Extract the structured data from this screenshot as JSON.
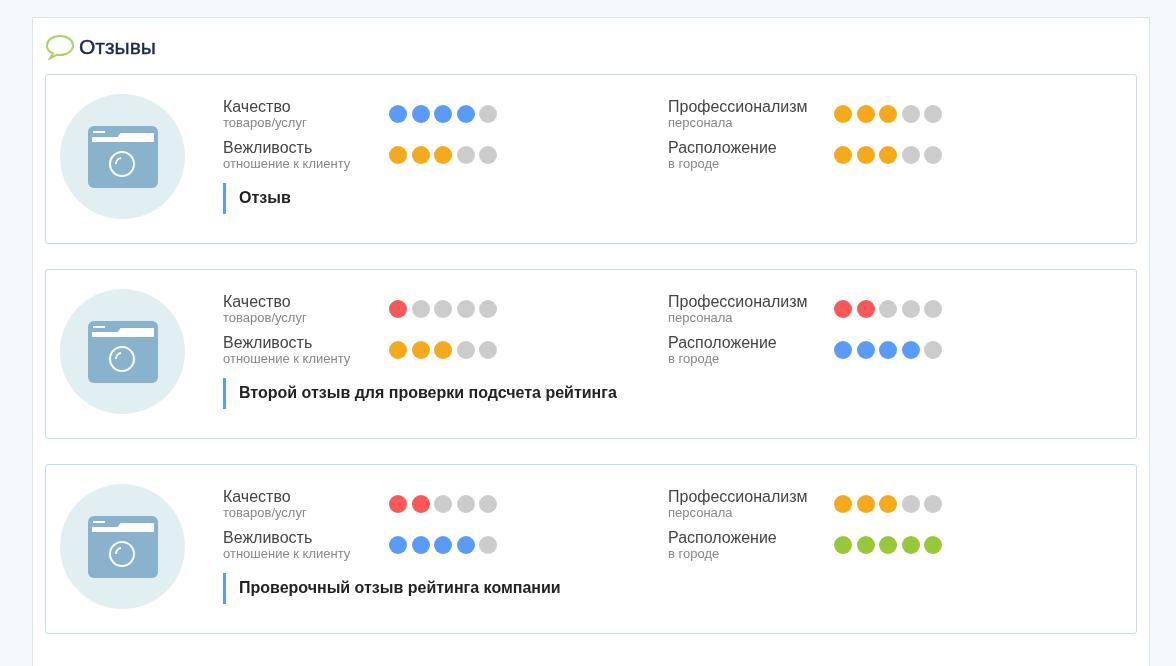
{
  "title": "Отзывы",
  "reviews": [
    {
      "ratings": [
        {
          "label": "Качество",
          "sublabel": "товаров/услуг",
          "stars": 4
        },
        {
          "label": "Профессионализм",
          "sublabel": "персонала",
          "stars": 3
        },
        {
          "label": "Вежливость",
          "sublabel": "отношение к клиенту",
          "stars": 3
        },
        {
          "label": "Расположение",
          "sublabel": "в городе",
          "stars": 3
        }
      ],
      "comment": "Отзыв"
    },
    {
      "ratings": [
        {
          "label": "Качество",
          "sublabel": "товаров/услуг",
          "stars": 1
        },
        {
          "label": "Профессионализм",
          "sublabel": "персонала",
          "stars": 2
        },
        {
          "label": "Вежливость",
          "sublabel": "отношение к клиенту",
          "stars": 3
        },
        {
          "label": "Расположение",
          "sublabel": "в городе",
          "stars": 4
        }
      ],
      "comment": "Второй отзыв для проверки подсчета рейтинга"
    },
    {
      "ratings": [
        {
          "label": "Качество",
          "sublabel": "товаров/услуг",
          "stars": 2
        },
        {
          "label": "Профессионализм",
          "sublabel": "персонала",
          "stars": 3
        },
        {
          "label": "Вежливость",
          "sublabel": "отношение к клиенту",
          "stars": 4
        },
        {
          "label": "Расположение",
          "sublabel": "в городе",
          "stars": 5
        }
      ],
      "comment": "Проверочный отзыв рейтинга компании"
    }
  ]
}
